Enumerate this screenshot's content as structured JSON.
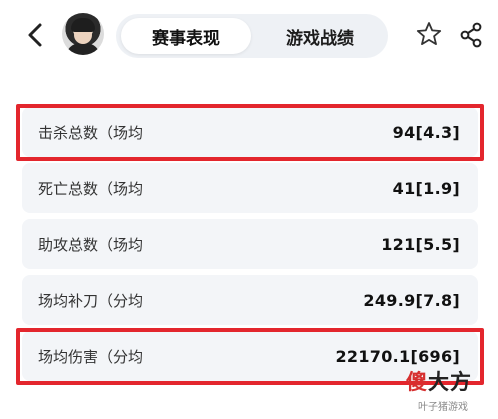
{
  "header": {
    "tabs": [
      {
        "label": "赛事表现",
        "active": true
      },
      {
        "label": "游戏战绩",
        "active": false
      }
    ],
    "icons": [
      "back-icon",
      "avatar",
      "star-icon",
      "share-icon"
    ]
  },
  "stats": [
    {
      "label": "击杀总数（场均",
      "value": "94[4.3]",
      "highlighted": true
    },
    {
      "label": "死亡总数（场均",
      "value": "41[1.9]",
      "highlighted": false
    },
    {
      "label": "助攻总数（场均",
      "value": "121[5.5]",
      "highlighted": false
    },
    {
      "label": "场均补刀（分均",
      "value": "249.9[7.8]",
      "highlighted": false
    },
    {
      "label": "场均伤害（分均",
      "value": "22170.1[696]",
      "highlighted": true
    }
  ],
  "watermark": {
    "brand_part1": "傻",
    "brand_part2": "大方",
    "caption": "叶子猪游戏"
  },
  "colors": {
    "highlight": "#e3262d",
    "row_background": "#f3f5f8",
    "segment_background": "#eef1f5"
  }
}
